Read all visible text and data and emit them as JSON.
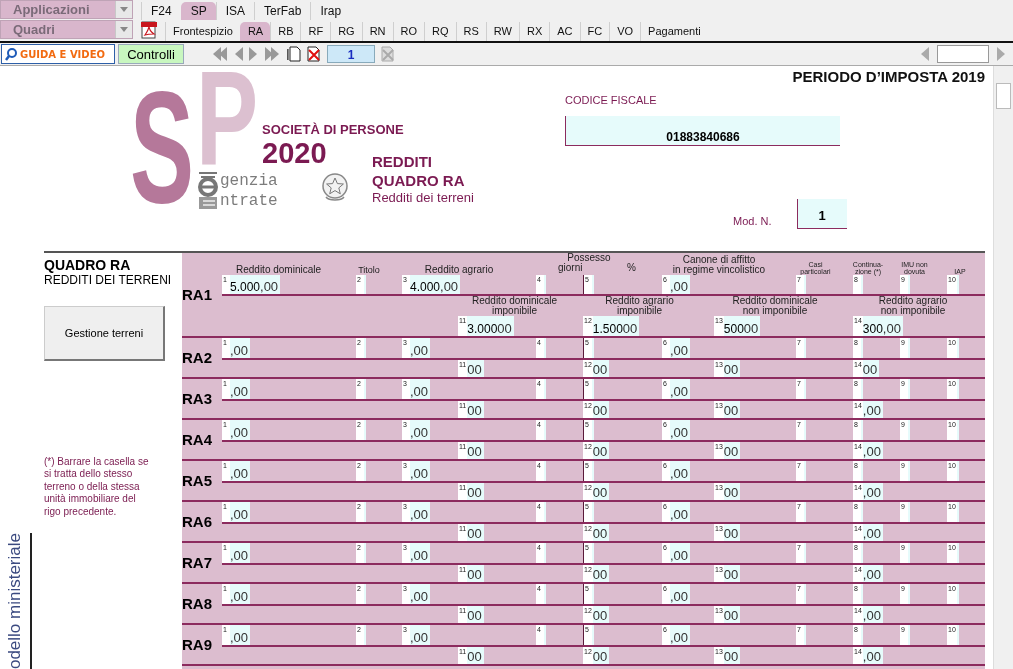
{
  "menus": [
    {
      "label": "Applicazioni"
    },
    {
      "label": "Quadri"
    }
  ],
  "app_tabs": [
    {
      "label": "F24",
      "selected": false
    },
    {
      "label": "SP",
      "selected": true
    },
    {
      "label": "ISA",
      "selected": false
    },
    {
      "label": "TerFab",
      "selected": false
    },
    {
      "label": "Irap",
      "selected": false
    }
  ],
  "quadri_tabs": [
    {
      "label": "Frontespizio",
      "selected": false
    },
    {
      "label": "RA",
      "selected": true
    },
    {
      "label": "RB",
      "selected": false
    },
    {
      "label": "RF",
      "selected": false
    },
    {
      "label": "RG",
      "selected": false
    },
    {
      "label": "RN",
      "selected": false
    },
    {
      "label": "RO",
      "selected": false
    },
    {
      "label": "RQ",
      "selected": false
    },
    {
      "label": "RS",
      "selected": false
    },
    {
      "label": "RW",
      "selected": false
    },
    {
      "label": "RX",
      "selected": false
    },
    {
      "label": "AC",
      "selected": false
    },
    {
      "label": "FC",
      "selected": false
    },
    {
      "label": "VO",
      "selected": false
    },
    {
      "label": "Pagamenti",
      "selected": false
    }
  ],
  "toolbar": {
    "guide_button": "GUIDA E VIDEO",
    "check_button": "Controlli",
    "page": "1"
  },
  "header": {
    "logo": {
      "letters": [
        "S",
        "P"
      ],
      "title": "SOCIETÀ DI PERSONE",
      "year": "2020",
      "agency": [
        "genzia",
        "ntrate"
      ]
    },
    "section": [
      "REDDITI",
      "QUADRO RA",
      "Redditi dei terreni"
    ],
    "period": "PERIODO D’IMPOSTA 2019",
    "tax_code_label": "CODICE FISCALE",
    "tax_code": "01883840686",
    "module_label": "Mod. N.",
    "module_number": "1"
  },
  "sidebar": {
    "title": "QUADRO RA",
    "subtitle": "REDDITI DEI TERRENI",
    "button": "Gestione terreni",
    "note": "(*) Barrare la casella se si tratta dello stesso terreno o della stessa unità immobiliare del rigo precedente.",
    "side_label": "odello ministeriale"
  },
  "headers_top": [
    "Reddito dominicale",
    "Titolo",
    "Reddito agrario",
    "Possesso",
    "giorni",
    "%",
    "Canone di affitto\nin regime vincolistico",
    "Casi\nparticolari",
    "Continua-\nzione (*)",
    "IMU non\ndovuta",
    "IAP"
  ],
  "headers_bottom": [
    "Reddito dominicale\nimponibile",
    "Reddito agrario\nimponibile",
    "Reddito dominicale\nnon imponibile",
    "Reddito agrario\nnon imponibile"
  ],
  "rows": [
    {
      "label": "RA1",
      "top": [
        {
          "n": "1",
          "value": "5.000",
          "cents": ",00"
        },
        {
          "n": "2"
        },
        {
          "n": "3",
          "value": "4.000",
          "cents": ",00"
        },
        {
          "n": "4"
        },
        {
          "n": "5"
        },
        {
          "n": "6",
          "cents": ",00"
        },
        {
          "n": "7"
        },
        {
          "n": "8"
        },
        {
          "n": "9"
        },
        {
          "n": "10"
        }
      ],
      "bottom": [
        {
          "n": "11",
          "value": "3.000",
          "cents": "00"
        },
        {
          "n": "12",
          "value": "1.500",
          "cents": "00"
        },
        {
          "n": "13",
          "value": "500",
          "cents": "00"
        },
        {
          "n": "14",
          "value": "300",
          "cents": ",00"
        }
      ]
    },
    {
      "label": "RA2",
      "top": [
        {
          "n": "1",
          "cents": ",00"
        },
        {
          "n": "2"
        },
        {
          "n": "3",
          "cents": ",00"
        },
        {
          "n": "4"
        },
        {
          "n": "5"
        },
        {
          "n": "6",
          "cents": ",00"
        },
        {
          "n": "7"
        },
        {
          "n": "8"
        },
        {
          "n": "9"
        },
        {
          "n": "10"
        }
      ],
      "bottom": [
        {
          "n": "11",
          "cents": "00"
        },
        {
          "n": "12",
          "cents": "00"
        },
        {
          "n": "13",
          "cents": "00"
        },
        {
          "n": "14",
          "cents": "00"
        }
      ]
    },
    {
      "label": "RA3",
      "top": [
        {
          "n": "1",
          "cents": ",00"
        },
        {
          "n": "2"
        },
        {
          "n": "3",
          "cents": ",00"
        },
        {
          "n": "4"
        },
        {
          "n": "5"
        },
        {
          "n": "6",
          "cents": ",00"
        },
        {
          "n": "7"
        },
        {
          "n": "8"
        },
        {
          "n": "9"
        },
        {
          "n": "10"
        }
      ],
      "bottom": [
        {
          "n": "11",
          "cents": "00"
        },
        {
          "n": "12",
          "cents": "00"
        },
        {
          "n": "13",
          "cents": "00"
        },
        {
          "n": "14",
          "cents": ",00"
        }
      ]
    },
    {
      "label": "RA4",
      "top": [
        {
          "n": "1",
          "cents": ",00"
        },
        {
          "n": "2"
        },
        {
          "n": "3",
          "cents": ",00"
        },
        {
          "n": "4"
        },
        {
          "n": "5"
        },
        {
          "n": "6",
          "cents": ",00"
        },
        {
          "n": "7"
        },
        {
          "n": "8"
        },
        {
          "n": "9"
        },
        {
          "n": "10"
        }
      ],
      "bottom": [
        {
          "n": "11",
          "cents": "00"
        },
        {
          "n": "12",
          "cents": "00"
        },
        {
          "n": "13",
          "cents": "00"
        },
        {
          "n": "14",
          "cents": ",00"
        }
      ]
    },
    {
      "label": "RA5",
      "top": [
        {
          "n": "1",
          "cents": ",00"
        },
        {
          "n": "2"
        },
        {
          "n": "3",
          "cents": ",00"
        },
        {
          "n": "4"
        },
        {
          "n": "5"
        },
        {
          "n": "6",
          "cents": ",00"
        },
        {
          "n": "7"
        },
        {
          "n": "8"
        },
        {
          "n": "9"
        },
        {
          "n": "10"
        }
      ],
      "bottom": [
        {
          "n": "11",
          "cents": "00"
        },
        {
          "n": "12",
          "cents": "00"
        },
        {
          "n": "13",
          "cents": "00"
        },
        {
          "n": "14",
          "cents": ",00"
        }
      ]
    },
    {
      "label": "RA6",
      "top": [
        {
          "n": "1",
          "cents": ",00"
        },
        {
          "n": "2"
        },
        {
          "n": "3",
          "cents": ",00"
        },
        {
          "n": "4"
        },
        {
          "n": "5"
        },
        {
          "n": "6",
          "cents": ",00"
        },
        {
          "n": "7"
        },
        {
          "n": "8"
        },
        {
          "n": "9"
        },
        {
          "n": "10"
        }
      ],
      "bottom": [
        {
          "n": "11",
          "cents": "00"
        },
        {
          "n": "12",
          "cents": "00"
        },
        {
          "n": "13",
          "cents": "00"
        },
        {
          "n": "14",
          "cents": ",00"
        }
      ]
    },
    {
      "label": "RA7",
      "top": [
        {
          "n": "1",
          "cents": ",00"
        },
        {
          "n": "2"
        },
        {
          "n": "3",
          "cents": ",00"
        },
        {
          "n": "4"
        },
        {
          "n": "5"
        },
        {
          "n": "6",
          "cents": ",00"
        },
        {
          "n": "7"
        },
        {
          "n": "8"
        },
        {
          "n": "9"
        },
        {
          "n": "10"
        }
      ],
      "bottom": [
        {
          "n": "11",
          "cents": "00"
        },
        {
          "n": "12",
          "cents": "00"
        },
        {
          "n": "13",
          "cents": "00"
        },
        {
          "n": "14",
          "cents": ",00"
        }
      ]
    },
    {
      "label": "RA8",
      "top": [
        {
          "n": "1",
          "cents": ",00"
        },
        {
          "n": "2"
        },
        {
          "n": "3",
          "cents": ",00"
        },
        {
          "n": "4"
        },
        {
          "n": "5"
        },
        {
          "n": "6",
          "cents": ",00"
        },
        {
          "n": "7"
        },
        {
          "n": "8"
        },
        {
          "n": "9"
        },
        {
          "n": "10"
        }
      ],
      "bottom": [
        {
          "n": "11",
          "cents": "00"
        },
        {
          "n": "12",
          "cents": "00"
        },
        {
          "n": "13",
          "cents": "00"
        },
        {
          "n": "14",
          "cents": ",00"
        }
      ]
    },
    {
      "label": "RA9",
      "top": [
        {
          "n": "1",
          "cents": ",00"
        },
        {
          "n": "2"
        },
        {
          "n": "3",
          "cents": ",00"
        },
        {
          "n": "4"
        },
        {
          "n": "5"
        },
        {
          "n": "6",
          "cents": ",00"
        },
        {
          "n": "7"
        },
        {
          "n": "8"
        },
        {
          "n": "9"
        },
        {
          "n": "10"
        }
      ],
      "bottom": [
        {
          "n": "11",
          "cents": "00"
        },
        {
          "n": "12",
          "cents": "00"
        },
        {
          "n": "13",
          "cents": "00"
        },
        {
          "n": "14",
          "cents": ",00"
        }
      ]
    }
  ]
}
